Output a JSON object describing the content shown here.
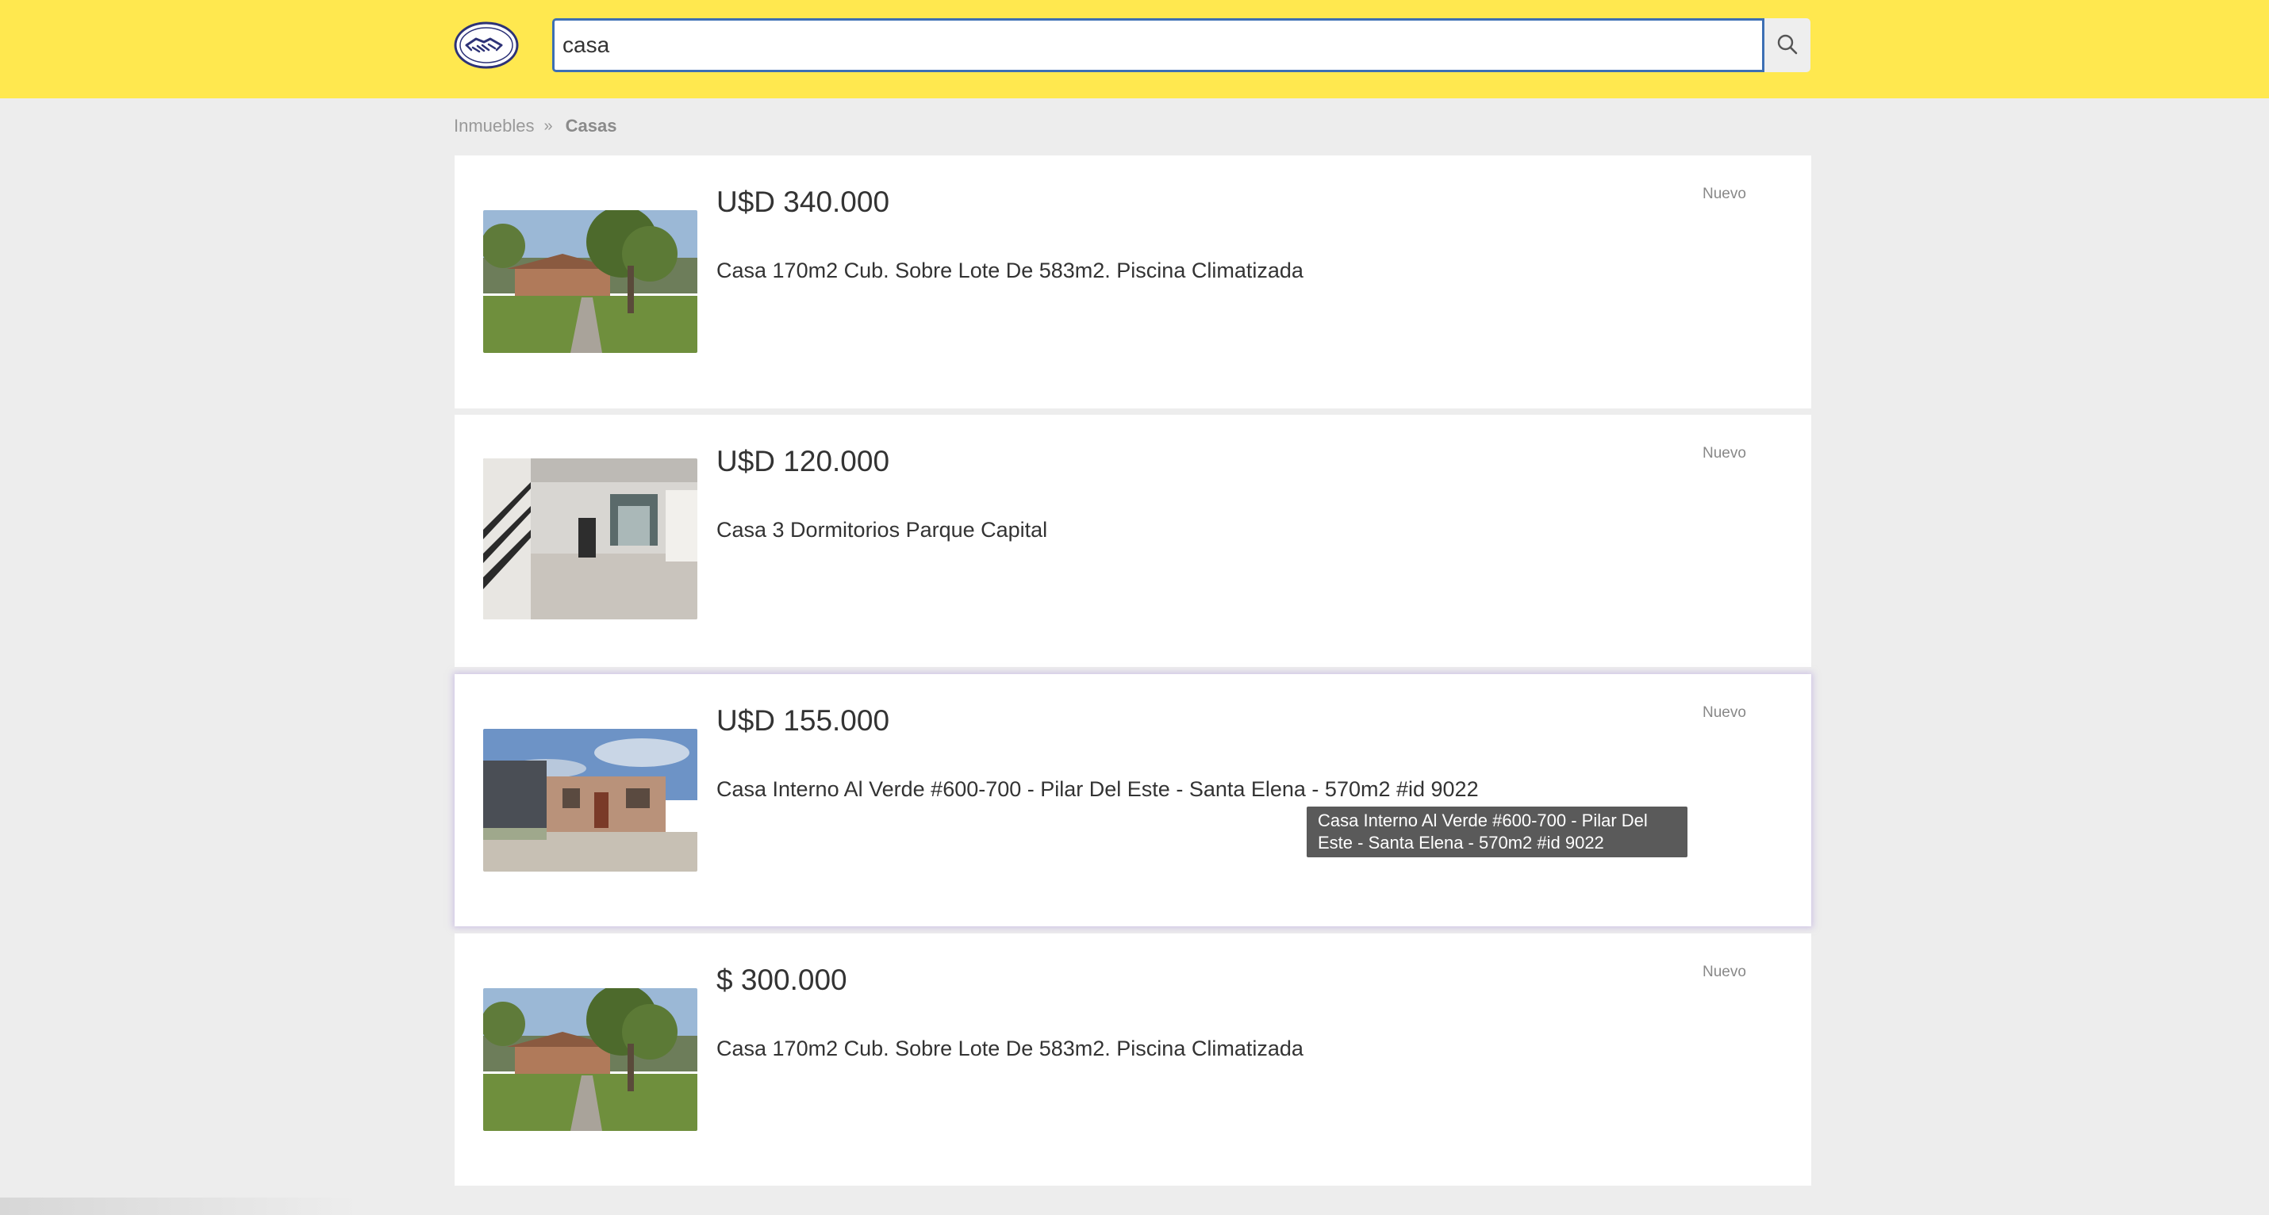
{
  "search": {
    "value": "casa",
    "button_icon": "search-icon"
  },
  "header": {
    "logo_icon": "handshake-logo-icon",
    "background_color": "#ffe84f"
  },
  "breadcrumb": {
    "parent": "Inmuebles",
    "separator": "»",
    "current": "Casas"
  },
  "results": [
    {
      "price": "U$D 340.000",
      "title": "Casa 170m2 Cub. Sobre Lote De 583m2. Piscina Climatizada",
      "condition": "Nuevo",
      "image": "house-with-tree-photo"
    },
    {
      "price": "U$D 120.000",
      "title": "Casa 3 Dormitorios Parque Capital",
      "condition": "Nuevo",
      "image": "interior-staircase-photo"
    },
    {
      "price": "U$D 155.000",
      "title": "Casa Interno Al Verde #600-700 - Pilar Del Este - Santa Elena - 570m2 #id 9022",
      "condition": "Nuevo",
      "image": "brick-house-photo"
    },
    {
      "price": "$ 300.000",
      "title": "Casa 170m2 Cub. Sobre Lote De 583m2. Piscina Climatizada",
      "condition": "Nuevo",
      "image": "house-with-tree-photo"
    }
  ],
  "tooltip": {
    "line1": "Casa Interno Al Verde #600-700 - Pilar Del",
    "line2": "Este - Santa Elena - 570m2 #id 9022"
  }
}
